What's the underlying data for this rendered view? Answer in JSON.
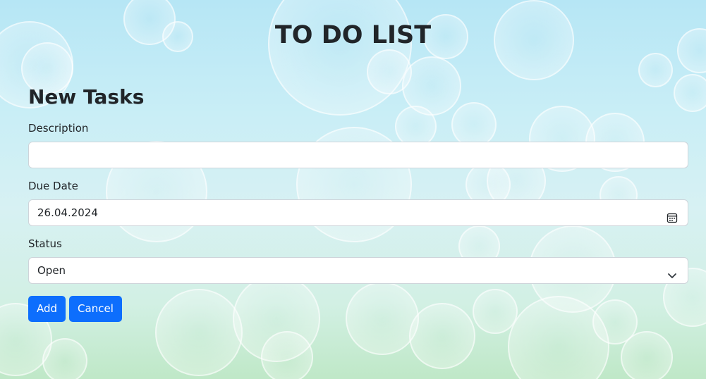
{
  "header": {
    "title": "TO DO LIST"
  },
  "form": {
    "section_title": "New Tasks",
    "description": {
      "label": "Description",
      "value": ""
    },
    "due_date": {
      "label": "Due Date",
      "value": "26.04.2024",
      "icon": "calendar-icon"
    },
    "status": {
      "label": "Status",
      "selected": "Open",
      "icon": "chevron-down-icon"
    },
    "buttons": {
      "add_label": "Add",
      "cancel_label": "Cancel"
    }
  },
  "colors": {
    "primary_button": "#0d6efd",
    "text": "#212529",
    "input_border": "#ced4da"
  }
}
